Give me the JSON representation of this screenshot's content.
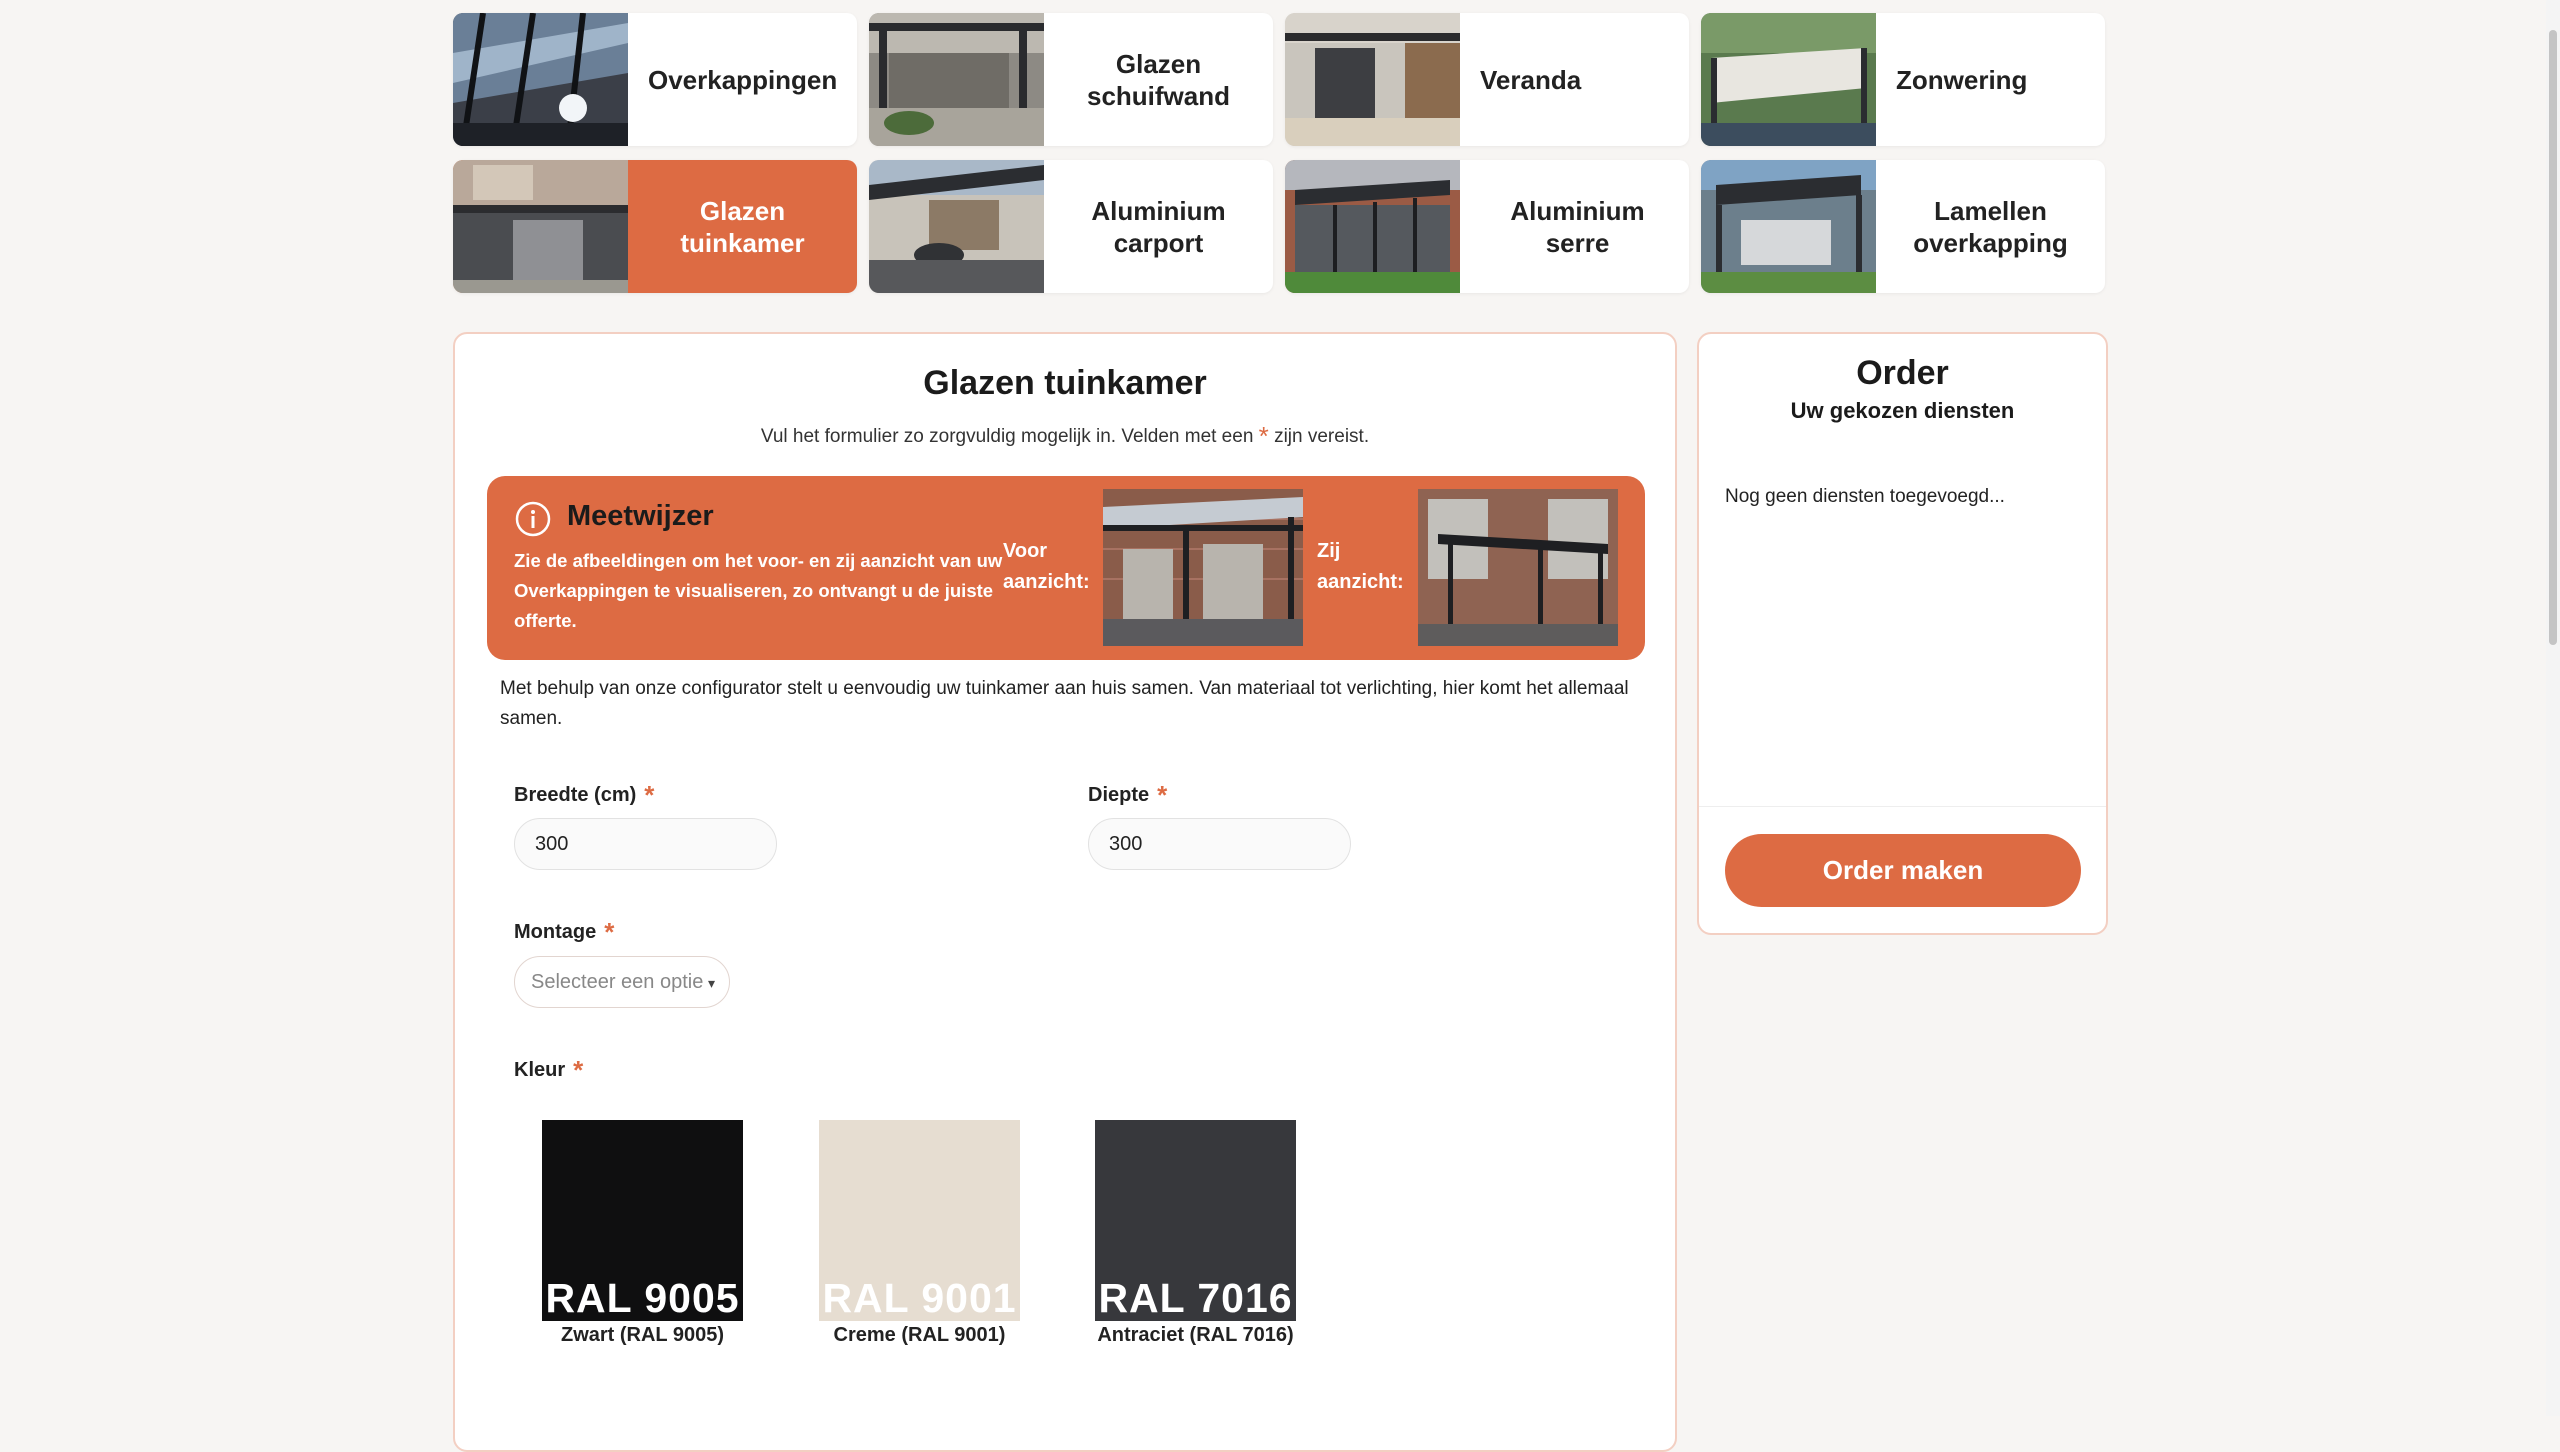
{
  "categories": [
    {
      "label": "Overkappingen",
      "active": false
    },
    {
      "label": "Glazen schuifwand",
      "active": false
    },
    {
      "label": "Veranda",
      "active": false
    },
    {
      "label": "Zonwering",
      "active": false
    },
    {
      "label": "Glazen tuinkamer",
      "active": true
    },
    {
      "label": "Aluminium carport",
      "active": false
    },
    {
      "label": "Aluminium serre",
      "active": false
    },
    {
      "label": "Lamellen overkapping",
      "active": false
    }
  ],
  "form": {
    "title": "Glazen tuinkamer",
    "subtitle_before": "Vul het formulier zo zorgvuldig mogelijk in. Velden met een",
    "required_mark": "*",
    "subtitle_after": "zijn vereist.",
    "guide": {
      "title": "Meetwijzer",
      "text": "Zie de afbeeldingen om het voor- en zij aanzicht van uw Overkappingen te visualiseren, zo ontvangt u de juiste offerte.",
      "front_label": "Voor aanzicht:",
      "side_label": "Zij aanzicht:"
    },
    "intro": "Met behulp van onze configurator stelt u eenvoudig uw tuinkamer aan huis samen. Van materiaal tot verlichting, hier komt het allemaal samen.",
    "width": {
      "label": "Breedte (cm)",
      "value": "300"
    },
    "depth": {
      "label": "Diepte",
      "value": "300"
    },
    "mounting": {
      "label": "Montage",
      "placeholder": "Selecteer een optie"
    },
    "color": {
      "label": "Kleur",
      "options": [
        {
          "code": "RAL 9005",
          "caption": "Zwart (RAL 9005)",
          "hex": "#0f0f10",
          "text_hex": "#ffffff"
        },
        {
          "code": "RAL 9001",
          "caption": "Creme (RAL 9001)",
          "hex": "#e6ddd1",
          "text_hex": "#ffffff"
        },
        {
          "code": "RAL 7016",
          "caption": "Antraciet (RAL 7016)",
          "hex": "#37383c",
          "text_hex": "#ffffff"
        }
      ]
    }
  },
  "order": {
    "title": "Order",
    "subtitle": "Uw gekozen diensten",
    "empty": "Nog geen diensten toegevoegd...",
    "button": "Order maken"
  },
  "colors": {
    "accent": "#dd6b43"
  }
}
